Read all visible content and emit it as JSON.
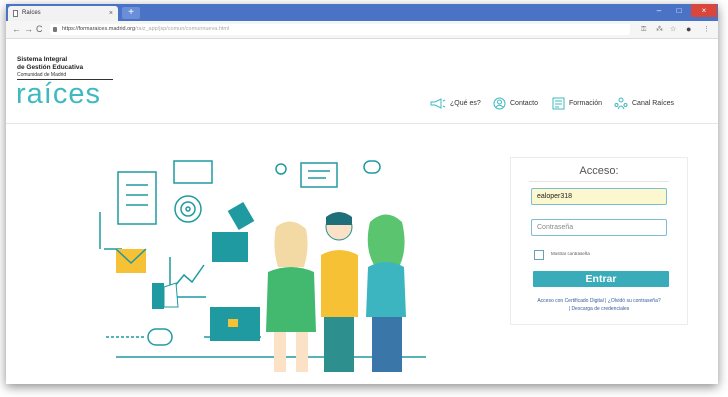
{
  "browser": {
    "tab_title": "Raíces",
    "tab_close": "×",
    "new_tab": "+",
    "window_min": "–",
    "window_max": "□",
    "window_close": "×",
    "nav_back": "←",
    "nav_forward": "→",
    "nav_reload": "C",
    "url_main": "https://formaraices.madrid.org",
    "url_rest": "/raiz_app/jsp/comun/comunnueva.html",
    "toolbar_icons": [
      "key-icon",
      "translate-icon",
      "star-icon",
      "account-icon",
      "menu-icon"
    ]
  },
  "header": {
    "brand_line1": "Sistema Integral",
    "brand_line2": "de Gestión Educativa",
    "brand_line3": "Comunidad de Madrid",
    "logo_text": "raíces",
    "nav": [
      {
        "label": "¿Qué es?",
        "icon": "megaphone-icon"
      },
      {
        "label": "Contacto",
        "icon": "contact-icon"
      },
      {
        "label": "Formación",
        "icon": "training-icon"
      },
      {
        "label": "Canal Raíces",
        "icon": "channel-icon"
      }
    ]
  },
  "login": {
    "title": "Acceso:",
    "username_value": "ealoper318",
    "password_placeholder": "Contraseña",
    "show_password_label": "Mostrar contraseña",
    "submit_label": "Entrar",
    "link_certificate": "Acceso con Certificado Digital",
    "link_forgot": "¿Olvidó su contraseña?",
    "link_download": "Descarga de credenciales",
    "separator": "|"
  },
  "colors": {
    "brand": "#3dbac0",
    "button": "#3aabb8",
    "titlebar": "#4a73c6",
    "input_autofill": "#fbf8cf"
  }
}
